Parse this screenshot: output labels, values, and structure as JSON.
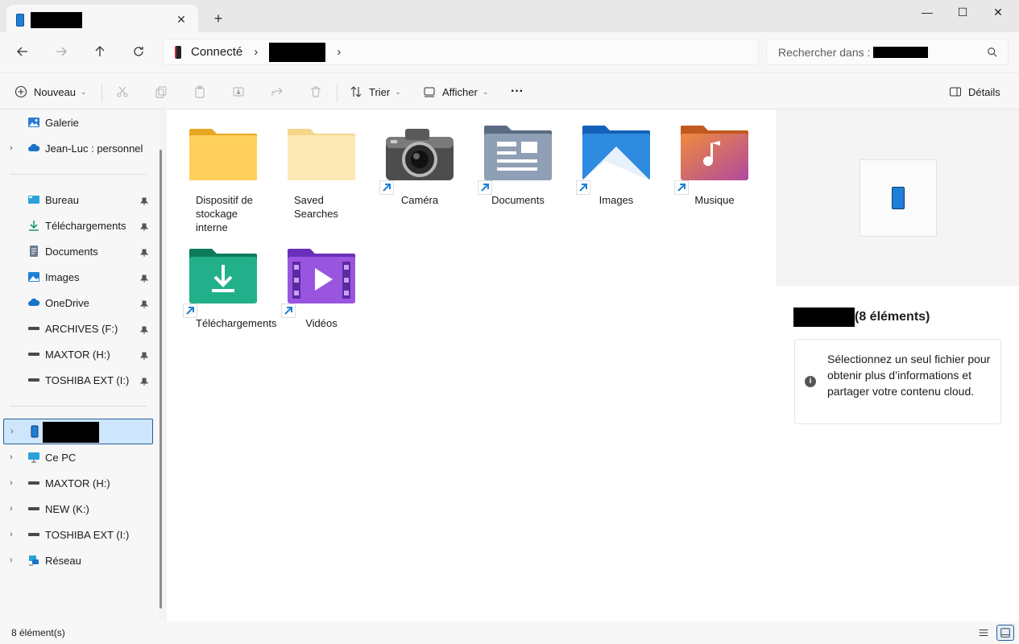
{
  "titlebar": {
    "tab_close": "✕",
    "new_tab": "+",
    "minimize": "—",
    "maximize": "☐",
    "close": "✕"
  },
  "address": {
    "segment1": "Connecté",
    "sep": "›",
    "search_placeholder": "Rechercher dans :"
  },
  "toolbar": {
    "new_label": "Nouveau",
    "sort_label": "Trier",
    "view_label": "Afficher",
    "more_label": "···",
    "details_label": "Détails",
    "caret": "⌄"
  },
  "sidebar": {
    "items": [
      {
        "label": "Galerie",
        "icon": "gallery-icon"
      },
      {
        "label": "Jean-Luc : personnel",
        "icon": "cloud-icon"
      },
      {
        "label": "Bureau",
        "icon": "desktop-icon"
      },
      {
        "label": "Téléchargements",
        "icon": "download-icon"
      },
      {
        "label": "Documents",
        "icon": "documents-icon"
      },
      {
        "label": "Images",
        "icon": "images-icon"
      },
      {
        "label": "OneDrive",
        "icon": "cloud-icon"
      },
      {
        "label": "ARCHIVES (F:)",
        "icon": "drive-icon"
      },
      {
        "label": "MAXTOR (H:)",
        "icon": "drive-icon"
      },
      {
        "label": "TOSHIBA EXT (I:)",
        "icon": "drive-icon"
      },
      {
        "label": "",
        "icon": "phone-icon"
      },
      {
        "label": "Ce PC",
        "icon": "pc-icon"
      },
      {
        "label": "MAXTOR (H:)",
        "icon": "drive-icon"
      },
      {
        "label": "NEW (K:)",
        "icon": "drive-icon"
      },
      {
        "label": "TOSHIBA EXT (I:)",
        "icon": "drive-icon"
      },
      {
        "label": "Réseau",
        "icon": "network-icon"
      }
    ]
  },
  "content": {
    "items": [
      {
        "label": "Dispositif de stockage interne",
        "icon": "folder-icon"
      },
      {
        "label": "Saved Searches",
        "icon": "folder-icon"
      },
      {
        "label": "Caméra",
        "icon": "camera-icon"
      },
      {
        "label": "Documents",
        "icon": "documents-folder-icon"
      },
      {
        "label": "Images",
        "icon": "images-folder-icon"
      },
      {
        "label": "Musique",
        "icon": "music-folder-icon"
      },
      {
        "label": "Téléchargements",
        "icon": "downloads-folder-icon"
      },
      {
        "label": "Vidéos",
        "icon": "videos-folder-icon"
      }
    ]
  },
  "details": {
    "count_label": "(8 éléments)",
    "info_icon": "i",
    "info_message": "Sélectionnez un seul fichier pour obtenir plus d’informations et partager votre contenu cloud."
  },
  "status": {
    "count": "8 élément(s)"
  },
  "colors": {
    "accent": "#1e7fd6",
    "selection_bg": "#cde6fb",
    "selection_border": "#2a5f97"
  }
}
